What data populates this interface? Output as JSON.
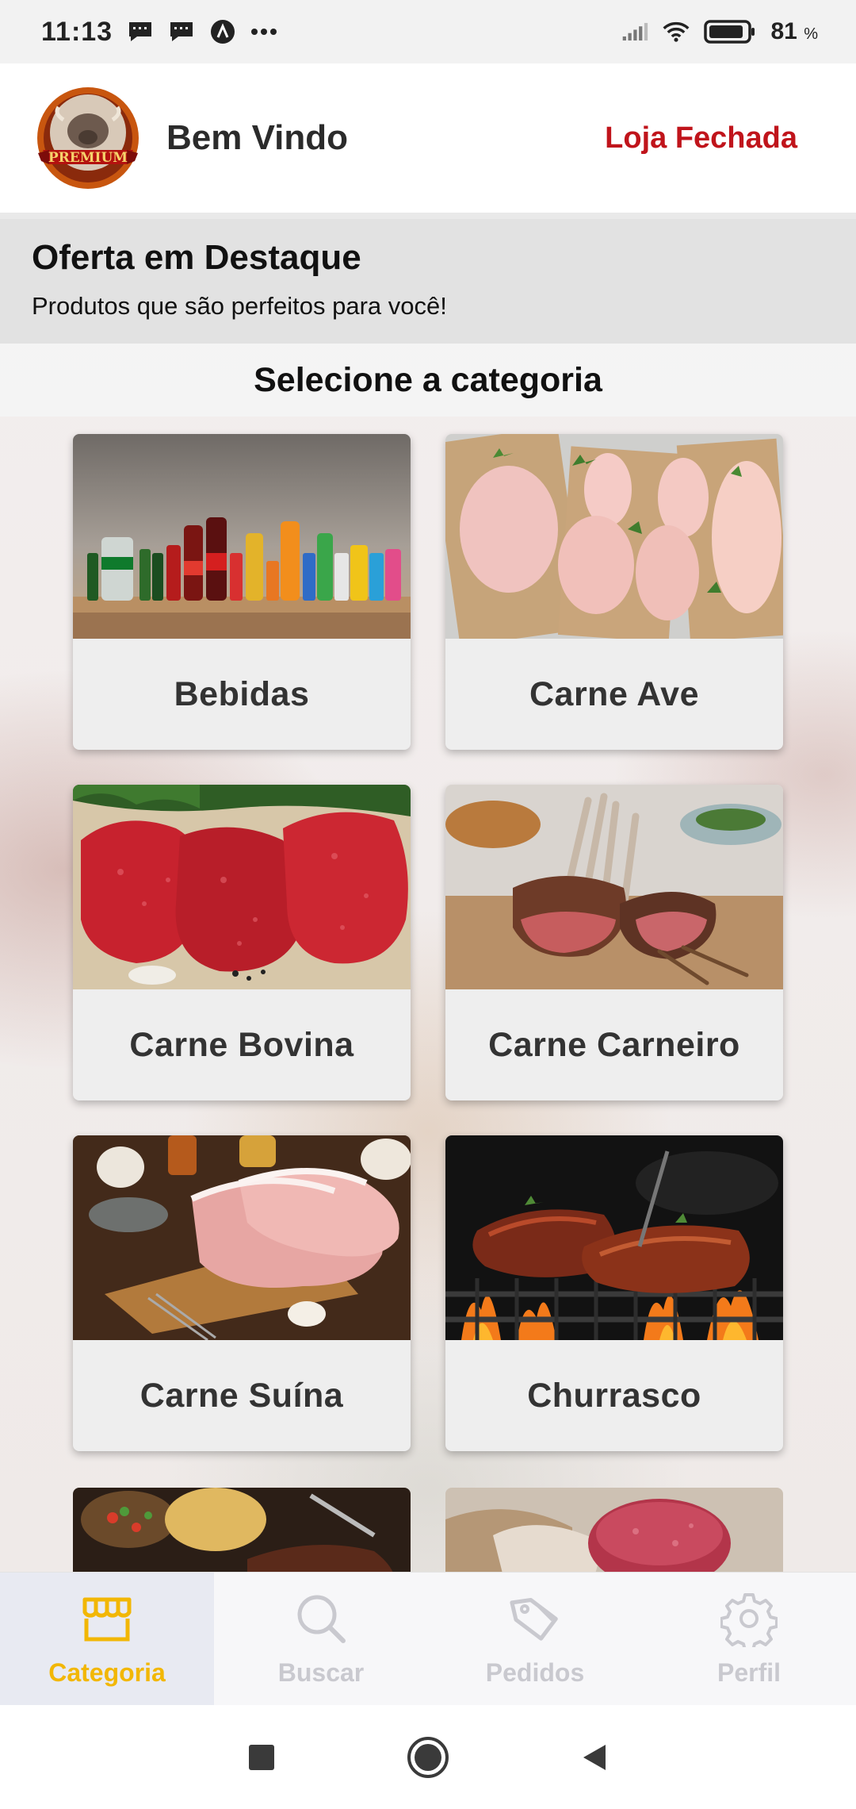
{
  "status_bar": {
    "time": "11:13",
    "battery_level": "81",
    "battery_unit": "%",
    "icons": [
      "message-icon",
      "message-icon",
      "app-a-icon",
      "more-dots-icon",
      "signal-icon",
      "wifi-icon",
      "battery-icon"
    ]
  },
  "header": {
    "logo_text": "PREMIUM",
    "welcome": "Bem Vindo",
    "store_status": "Loja Fechada"
  },
  "offer": {
    "title": "Oferta em Destaque",
    "subtitle": "Produtos que são perfeitos para você!"
  },
  "categories_heading": "Selecione a categoria",
  "categories": [
    {
      "label": "Bebidas"
    },
    {
      "label": "Carne Ave"
    },
    {
      "label": "Carne Bovina"
    },
    {
      "label": "Carne Carneiro"
    },
    {
      "label": "Carne Suína"
    },
    {
      "label": "Churrasco"
    }
  ],
  "bottom_nav": {
    "items": [
      {
        "label": "Categoria",
        "icon": "category-icon",
        "active": true
      },
      {
        "label": "Buscar",
        "icon": "search-icon",
        "active": false
      },
      {
        "label": "Pedidos",
        "icon": "tag-icon",
        "active": false
      },
      {
        "label": "Perfil",
        "icon": "gear-icon",
        "active": false
      }
    ]
  },
  "colors": {
    "accent": "#f2b705",
    "store_closed": "#c0141b",
    "nav_inactive": "#c9c9cf"
  }
}
